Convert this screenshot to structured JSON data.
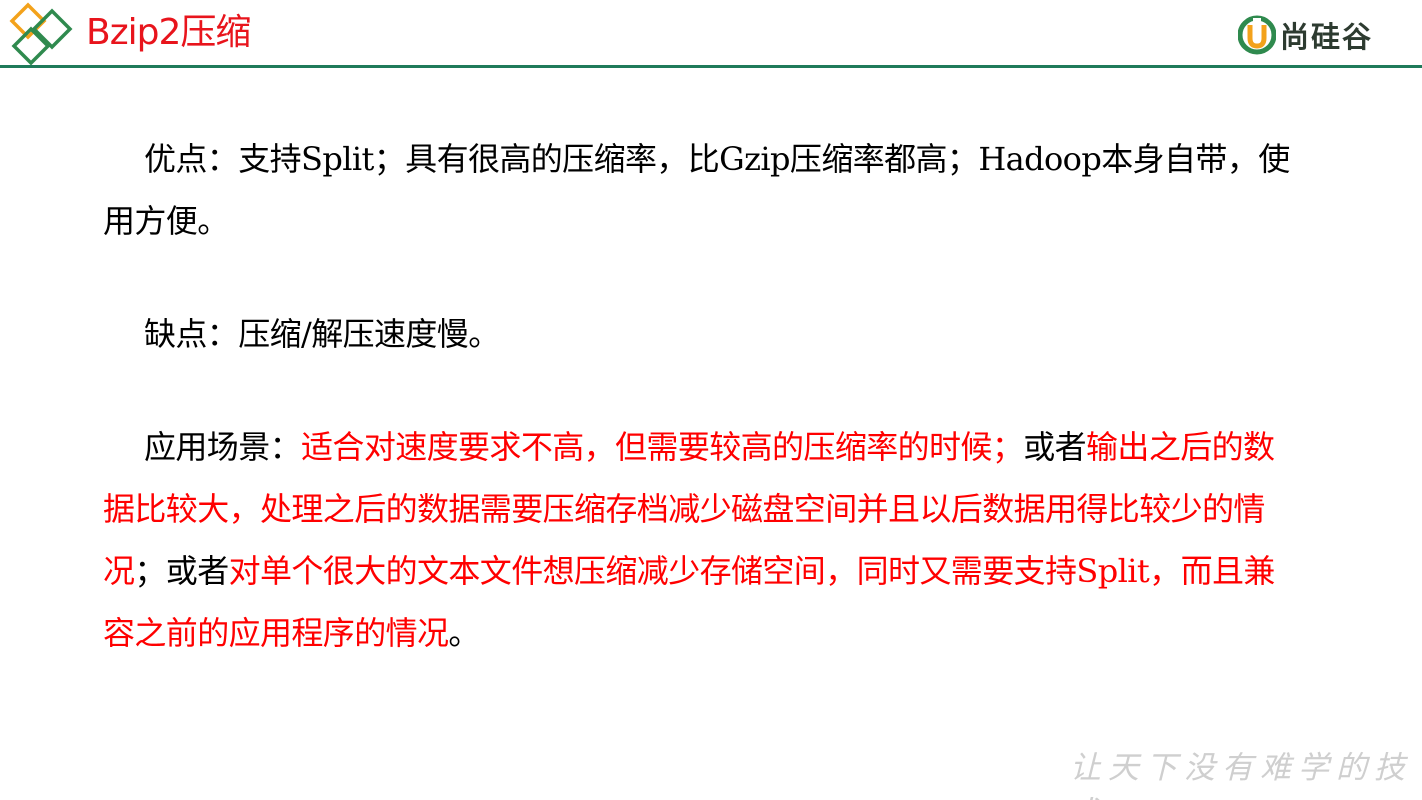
{
  "header": {
    "title": "Bzip2压缩",
    "brand_name": "尚硅谷",
    "colors": {
      "title": "#e8141c",
      "rule": "#1f7a5a",
      "brand": "#2d3b30",
      "brand_mark": "#2f8a4e",
      "brand_accent": "#f3a21b"
    }
  },
  "advantages": {
    "label": "优点：",
    "segments": [
      {
        "text": "支持",
        "latin": false
      },
      {
        "text": "Split",
        "latin": true
      },
      {
        "text": "；具有很高的压缩率，比",
        "latin": false
      },
      {
        "text": "Gzip",
        "latin": true
      },
      {
        "text": "压缩率都高；",
        "latin": false
      },
      {
        "text": "Hadoop",
        "latin": true
      },
      {
        "text": "本身自带，使用方便。",
        "latin": false
      }
    ]
  },
  "disadvantages": {
    "label": "缺点：",
    "segments": [
      {
        "text": "压缩",
        "latin": false
      },
      {
        "text": "/",
        "latin": true
      },
      {
        "text": "解压速度慢。",
        "latin": false
      }
    ]
  },
  "scenarios": {
    "label": "应用场景：",
    "segments": [
      {
        "text": "适合对速度要求不高，但需要较高的压缩率的时候；",
        "red": true,
        "latin": false
      },
      {
        "text": "或者",
        "red": false,
        "latin": false
      },
      {
        "text": "输出之后的数据比较大，处理之后的数据需要压缩存档减少磁盘空间并且以后数据用得比较少的情况",
        "red": true,
        "latin": false
      },
      {
        "text": "；或者",
        "red": false,
        "latin": false
      },
      {
        "text": "对单个很大的文本文件想压缩减少存储空间，同时又需要支持",
        "red": true,
        "latin": false
      },
      {
        "text": "Split",
        "red": true,
        "latin": true
      },
      {
        "text": "，而且兼容之前的应用程序的情况",
        "red": true,
        "latin": false
      },
      {
        "text": "。",
        "red": false,
        "latin": false
      }
    ]
  },
  "footer": {
    "slogan": "让天下没有难学的技术"
  }
}
